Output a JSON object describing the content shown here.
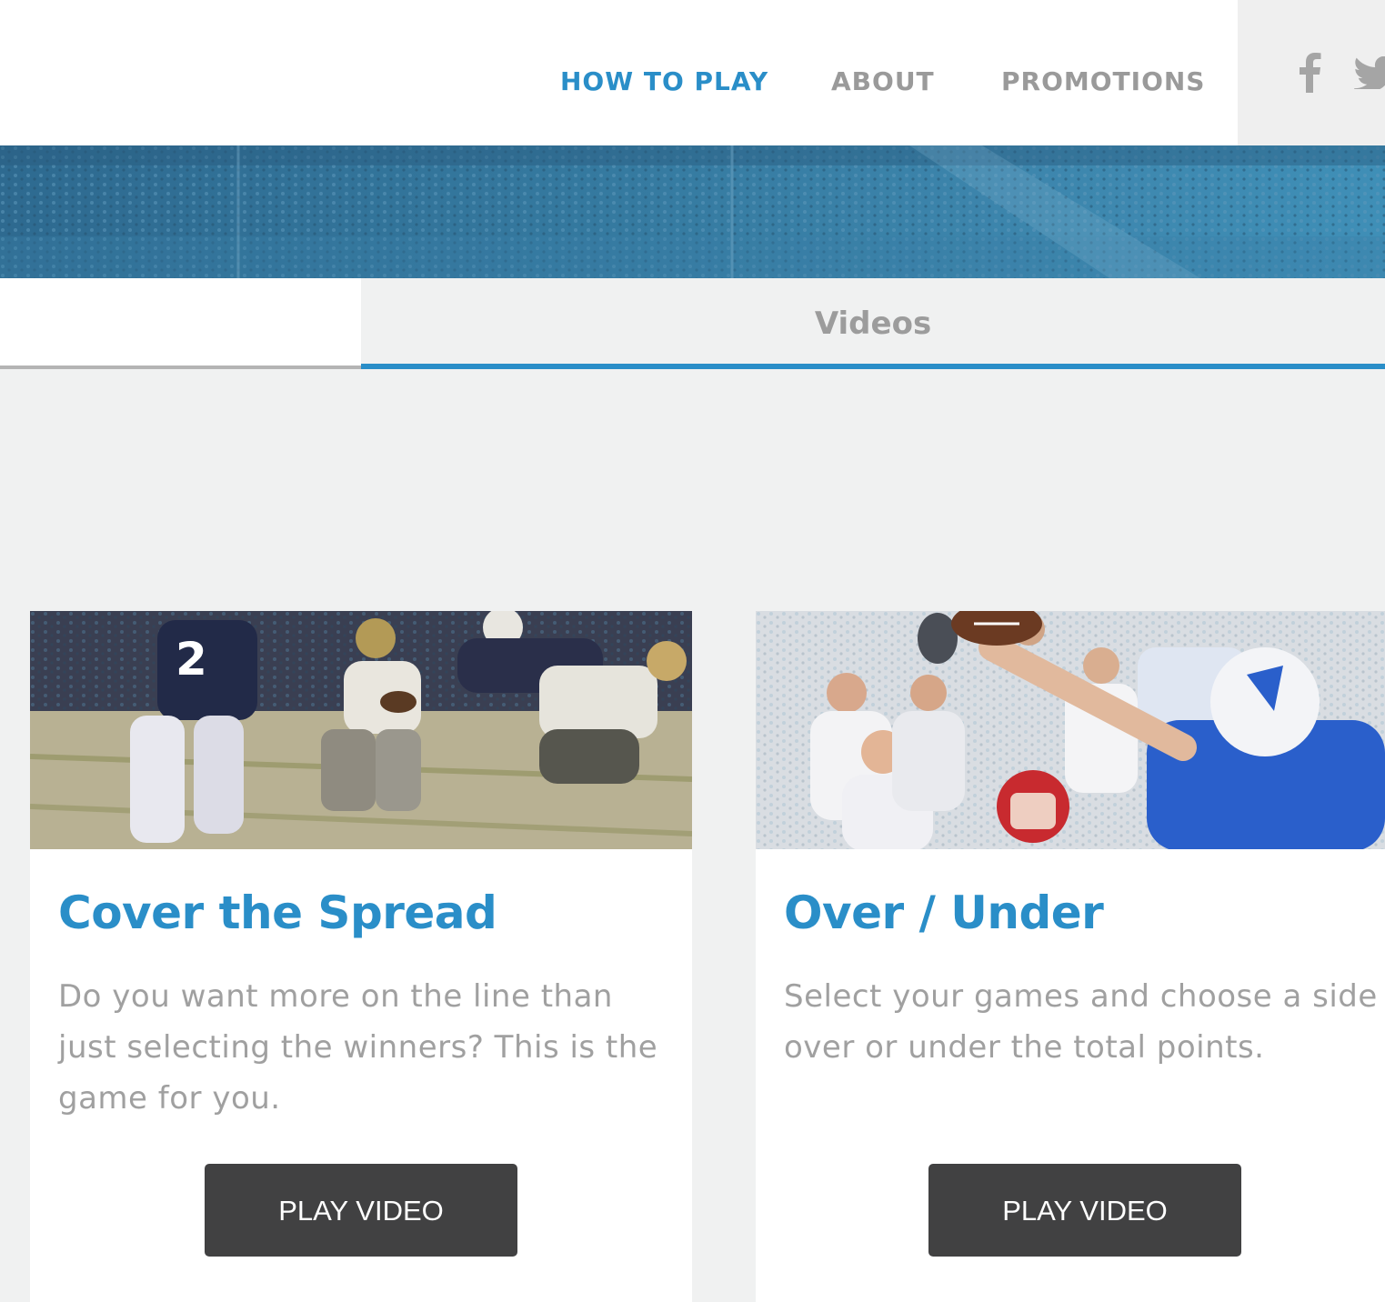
{
  "nav": {
    "items": [
      {
        "label": "HOW TO PLAY",
        "active": true
      },
      {
        "label": "ABOUT",
        "active": false
      },
      {
        "label": "PROMOTIONS",
        "active": false
      }
    ],
    "social_icons": [
      "facebook-icon",
      "twitter-icon"
    ]
  },
  "tabs": {
    "left_label": "",
    "videos_label": "Videos"
  },
  "cards": [
    {
      "title": "Cover the Spread",
      "description": "Do you want more on the line than just selecting the winners? This is the game for you.",
      "button_label": "PLAY VIDEO",
      "image": "football-players-running-photo"
    },
    {
      "title": "Over / Under",
      "description": "Select your games and choose a side over or under the total points.",
      "button_label": "PLAY VIDEO",
      "image": "football-player-catching-ball-photo"
    }
  ],
  "colors": {
    "accent": "#2a8ec8",
    "nav_inactive": "#9a9a9a",
    "button_bg": "#414142",
    "page_bg": "#f0f1f1",
    "hero_bg": "#357aa0"
  }
}
